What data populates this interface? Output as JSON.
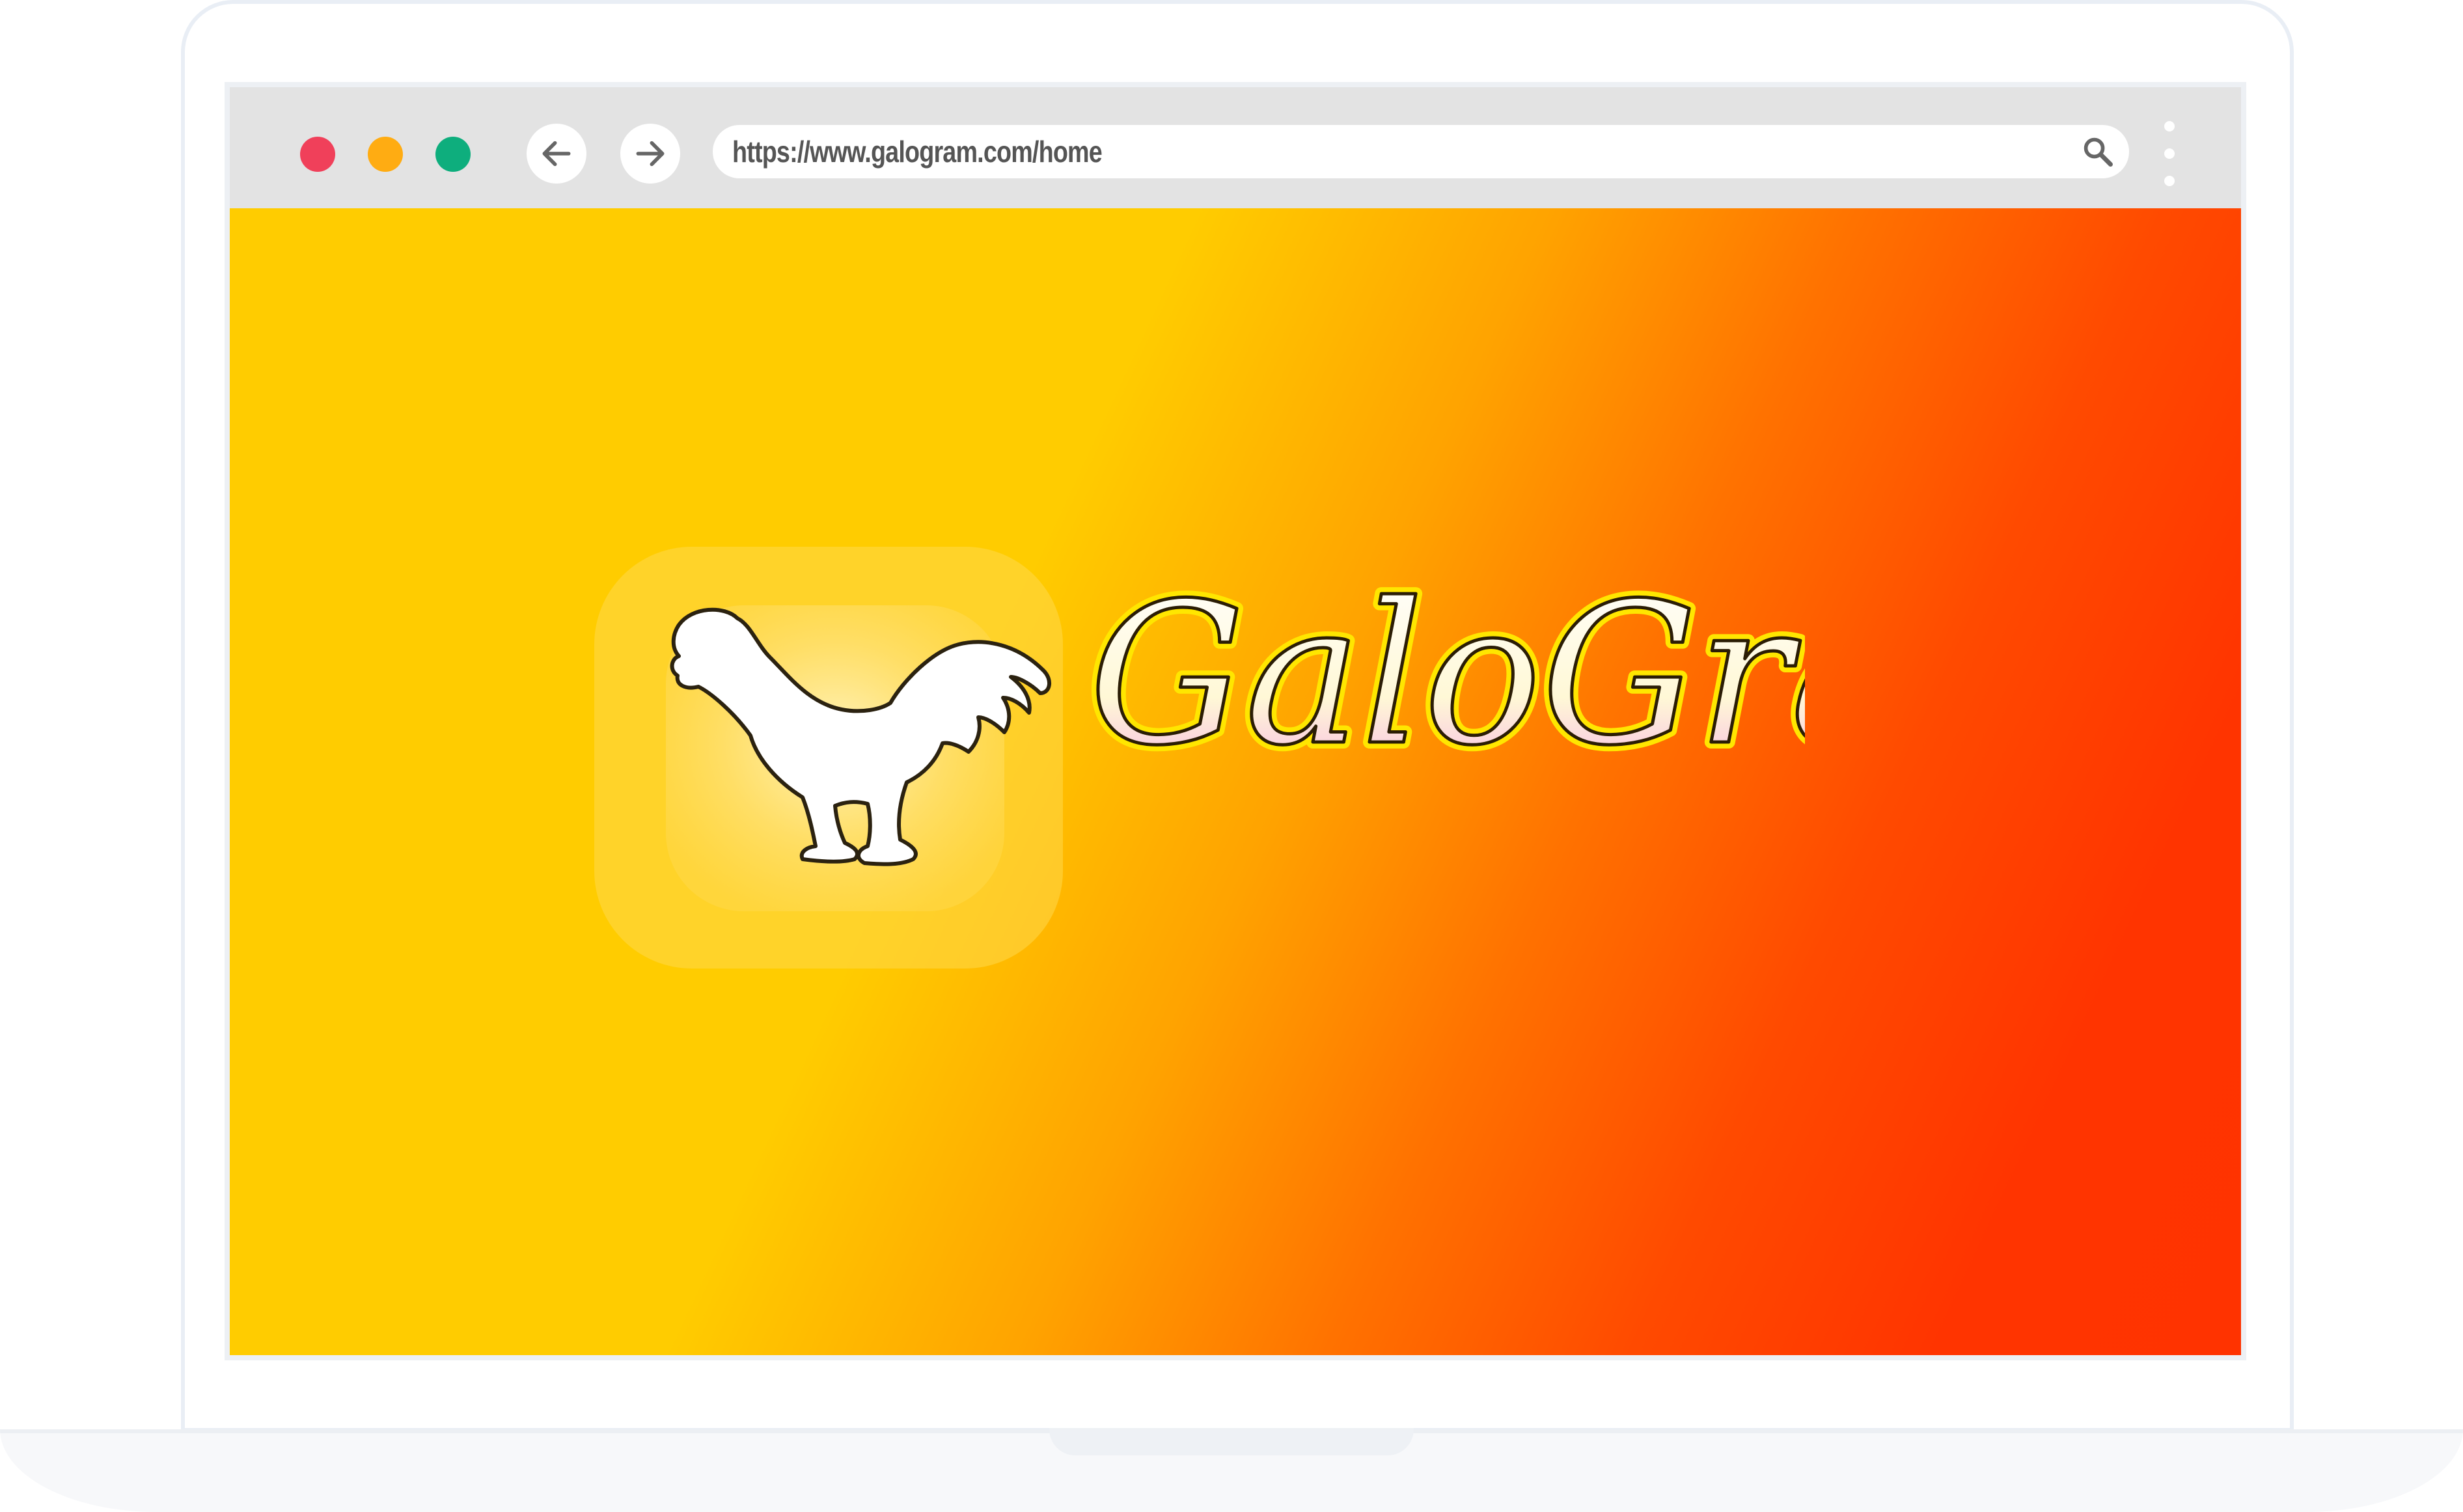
{
  "browser": {
    "url": "https://www.galogram.com/home",
    "window_controls": {
      "close_color": "#f0405a",
      "minimize_color": "#ffac12",
      "maximize_color": "#0eae7d"
    },
    "icons": {
      "back": "arrow-left-icon",
      "forward": "arrow-right-icon",
      "search": "search-icon",
      "menu": "kebab-menu-icon"
    }
  },
  "page": {
    "brand_name": "GaloGram",
    "logo_icon": "rooster-icon",
    "gradient": {
      "start": "#ffcc00",
      "end": "#ff3300"
    }
  }
}
